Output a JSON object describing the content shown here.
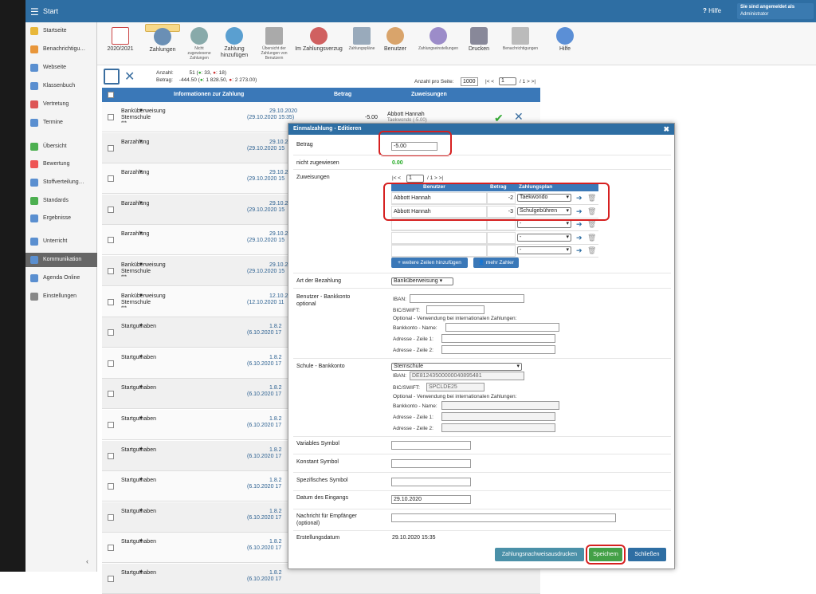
{
  "topbar": {
    "title": "Start",
    "help": "Hilfe",
    "user_line1": "Sie sind angemeldet als",
    "user_line2": "Administrator"
  },
  "sidebar": {
    "items": [
      "Startseite",
      "Benachrichtigu…",
      "Webseite",
      "Klassenbuch",
      "Vertretung",
      "Termine",
      "Übersicht",
      "Bewertung",
      "Stoffverteilung…",
      "Standards",
      "Ergebnisse",
      "Unterricht",
      "Kommunikation",
      "Agenda Online",
      "Einstellungen"
    ]
  },
  "toolbar": {
    "year": "2020/2021",
    "zahlungen": "Zahlungen",
    "nicht_zug": "Nicht zugewiesene Zahlungen",
    "zahlung_hinzu": "Zahlung hinzufügen",
    "uebersicht": "Übersicht der Zahlungen von Benutzern",
    "verzug": "Im Zahlungsverzug",
    "plaene": "Zahlungspläne",
    "benutzer": "Benutzer",
    "einstellungen": "Zahlungseinstellungen",
    "drucken": "Drucken",
    "benach": "Benachrichtigungen",
    "hilfe": "Hilfe"
  },
  "summary": {
    "anzahl_label": "Anzahl:",
    "anzahl": "51 (",
    "anzahl_g": ": 33, ",
    "anzahl_r": ": 18)",
    "betrag_label": "Betrag:",
    "betrag": "-444.50 (",
    "betrag_g": ": 1 828.50, ",
    "betrag_r": ": 2 273.00)",
    "per_page": "Anzahl pro Seite:",
    "per_page_val": "1000",
    "pager": "|< <",
    "page": "1",
    "pager2": "/ 1 > >|"
  },
  "table": {
    "col_info": "Informationen zur Zahlung",
    "col_betrag": "Betrag",
    "col_zuw": "Zuweisungen",
    "rows": [
      {
        "type": "Banküberweisung",
        "sub": "Sternschule",
        "extra": "***",
        "date": "29.10.2020",
        "date2": "(29.10.2020 15:35)",
        "amount": "-5.00",
        "zuw": "Abbott Hannah",
        "zuw2": "Taekwondo (-5.00)"
      },
      {
        "type": "Barzahlung",
        "sub": "",
        "extra": "",
        "date": "29.10.2",
        "date2": "(29.10.2020 15",
        "amount": "",
        "zuw": "",
        "zuw2": ""
      },
      {
        "type": "Barzahlung",
        "sub": "",
        "extra": "",
        "date": "29.10.2",
        "date2": "(29.10.2020 15",
        "amount": "",
        "zuw": "",
        "zuw2": ""
      },
      {
        "type": "Barzahlung",
        "sub": "",
        "extra": "",
        "date": "29.10.2",
        "date2": "(29.10.2020 15",
        "amount": "",
        "zuw": "",
        "zuw2": ""
      },
      {
        "type": "Barzahlung",
        "sub": "",
        "extra": "",
        "date": "29.10.2",
        "date2": "(29.10.2020 15",
        "amount": "",
        "zuw": "",
        "zuw2": ""
      },
      {
        "type": "Banküberweisung",
        "sub": "Sternschule",
        "extra": "***",
        "date": "29.10.2",
        "date2": "(29.10.2020 15",
        "amount": "",
        "zuw": "",
        "zuw2": ""
      },
      {
        "type": "Banküberweisung",
        "sub": "Sternschule",
        "extra": "***",
        "date": "12.10.2",
        "date2": "(12.10.2020 11",
        "amount": "",
        "zuw": "",
        "zuw2": ""
      },
      {
        "type": "Startguthaben",
        "sub": "",
        "extra": "",
        "date": "1.8.2",
        "date2": "(6.10.2020 17",
        "amount": "",
        "zuw": "",
        "zuw2": ""
      },
      {
        "type": "Startguthaben",
        "sub": "",
        "extra": "",
        "date": "1.8.2",
        "date2": "(6.10.2020 17",
        "amount": "",
        "zuw": "",
        "zuw2": ""
      },
      {
        "type": "Startguthaben",
        "sub": "",
        "extra": "",
        "date": "1.8.2",
        "date2": "(6.10.2020 17",
        "amount": "",
        "zuw": "",
        "zuw2": ""
      },
      {
        "type": "Startguthaben",
        "sub": "",
        "extra": "",
        "date": "1.8.2",
        "date2": "(6.10.2020 17",
        "amount": "",
        "zuw": "",
        "zuw2": ""
      },
      {
        "type": "Startguthaben",
        "sub": "",
        "extra": "",
        "date": "1.8.2",
        "date2": "(6.10.2020 17",
        "amount": "",
        "zuw": "",
        "zuw2": ""
      },
      {
        "type": "Startguthaben",
        "sub": "",
        "extra": "",
        "date": "1.8.2",
        "date2": "(6.10.2020 17",
        "amount": "",
        "zuw": "",
        "zuw2": ""
      },
      {
        "type": "Startguthaben",
        "sub": "",
        "extra": "",
        "date": "1.8.2",
        "date2": "(6.10.2020 17",
        "amount": "",
        "zuw": "",
        "zuw2": ""
      },
      {
        "type": "Startguthaben",
        "sub": "",
        "extra": "",
        "date": "1.8.2",
        "date2": "(6.10.2020 17",
        "amount": "",
        "zuw": "",
        "zuw2": ""
      },
      {
        "type": "Startguthaben",
        "sub": "",
        "extra": "",
        "date": "1.8.2",
        "date2": "(6.10.2020 17",
        "amount": "",
        "zuw": "",
        "zuw2": ""
      }
    ]
  },
  "modal": {
    "title": "Einmalzahlung - Editieren",
    "betrag_label": "Betrag",
    "betrag_val": "-5.00",
    "nicht_label": "nicht zugewiesen",
    "nicht_val": "0.00",
    "zuw_label": "Zuweisungen",
    "zuw_pager": "|< <",
    "zuw_page": "1",
    "zuw_pager2": "/ 1 > >|",
    "col_benutzer": "Benutzer",
    "col_betrag": "Betrag",
    "col_plan": "Zahlungsplan",
    "z_rows": [
      {
        "name": "Abbott Hannah",
        "amount": "-2",
        "plan": "Taekwondo"
      },
      {
        "name": "Abbott Hannah",
        "amount": "-3",
        "plan": "Schulgebühren"
      },
      {
        "name": "",
        "amount": "",
        "plan": "-"
      },
      {
        "name": "",
        "amount": "",
        "plan": "-"
      },
      {
        "name": "",
        "amount": "",
        "plan": "-"
      }
    ],
    "add_rows": "+ weitere Zeilen hinzufügen",
    "more_payers": "mehr Zahler",
    "art_label": "Art der Bezahlung",
    "art_val": "Banküberweisung",
    "bk_label": "Benutzer - Bankkonto",
    "bk_label2": "optional",
    "iban": "IBAN:",
    "bic": "BIC/SWIFT:",
    "opt_note": "Optional - Verwendung bei internationalen Zahlungen:",
    "bk_name": "Bankkonto - Name:",
    "addr1": "Adresse - Zeile 1:",
    "addr2": "Adresse - Zeile 2:",
    "sk_label": "Schule - Bankkonto",
    "sk_val": "Sternschule",
    "sk_iban": "DE81243500000040895481",
    "sk_bic": "SPCLDE25",
    "var_label": "Variables Symbol",
    "konst_label": "Konstant Symbol",
    "spez_label": "Spezifisches Symbol",
    "datum_label": "Datum des Eingangs",
    "datum_val": "29.10.2020",
    "nachricht_label": "Nachricht für Empfänger",
    "nachricht_label2": "(optional)",
    "erst_label": "Erstellungsdatum",
    "erst_val": "29.10.2020 15:35",
    "btn_print": "Zahlungsnachweisausdrucken",
    "btn_save": "Speichern",
    "btn_close": "Schließen"
  },
  "colors": {
    "blue": "#2e6ea3",
    "green": "#43a047",
    "red": "#d62020",
    "teal": "#4a90a8"
  }
}
